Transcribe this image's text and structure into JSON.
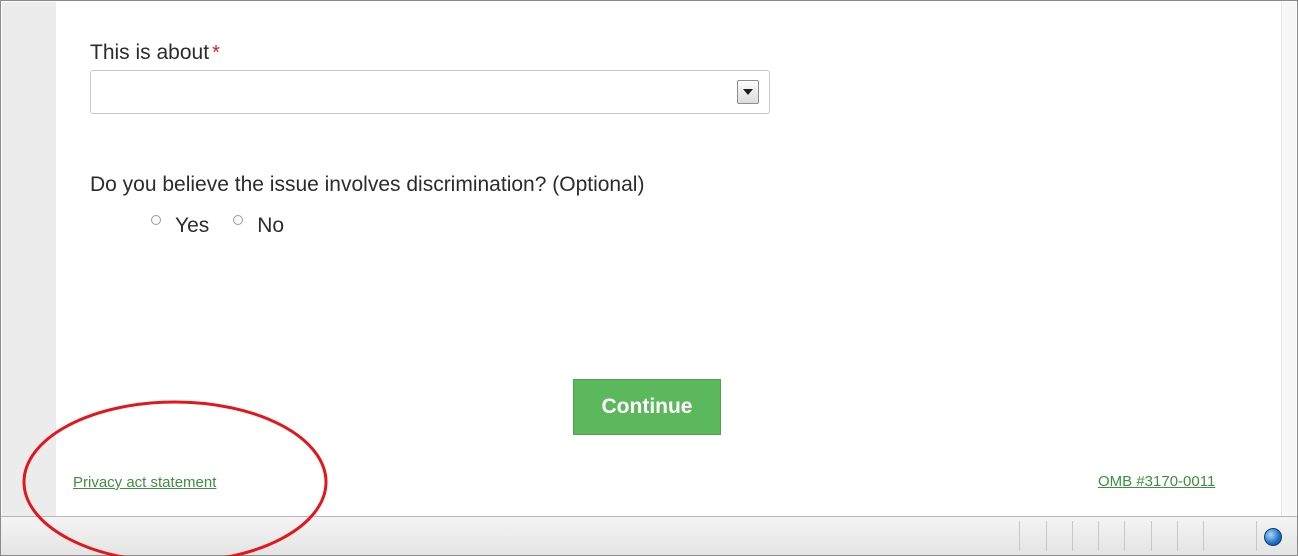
{
  "form": {
    "topic_label": "This is about",
    "required_mark": "*",
    "topic_select_value": "",
    "discrimination_question": "Do you believe the issue involves discrimination? (Optional)",
    "radio_options": [
      "Yes",
      "No"
    ],
    "continue_label": "Continue"
  },
  "footer": {
    "privacy_link": "Privacy act statement",
    "omb_link": "OMB #3170-0011"
  },
  "colors": {
    "button_green": "#5cb85c",
    "link_green": "#3f8f3f",
    "required_red": "#d21f1f",
    "annotation_red": "#e3171b"
  },
  "annotation": {
    "shape": "ellipse",
    "highlights": "privacy-link"
  }
}
